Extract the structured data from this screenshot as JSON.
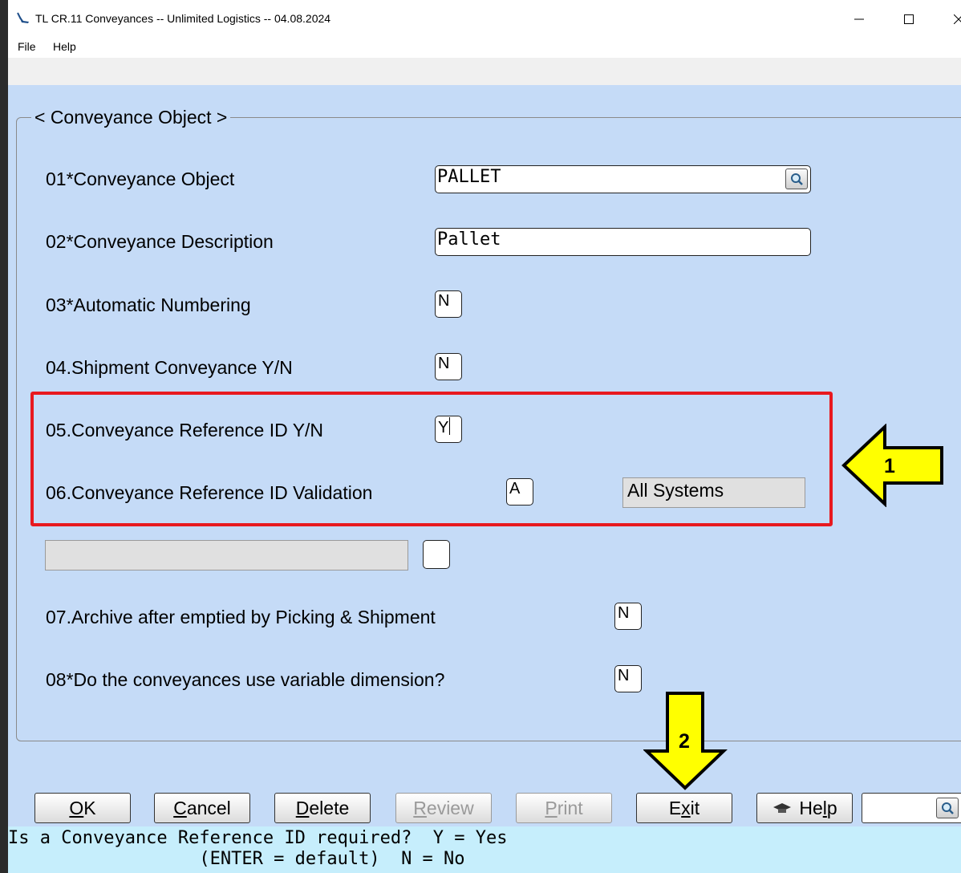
{
  "window": {
    "title": "TL CR.11 Conveyances -- Unlimited Logistics -- 04.08.2024",
    "menu": [
      "File",
      "Help"
    ]
  },
  "group_title": "< Conveyance Object >",
  "fields": [
    {
      "label": "01*Conveyance Object",
      "value": "PALLET"
    },
    {
      "label": "02*Conveyance Description",
      "value": "Pallet"
    },
    {
      "label": "03*Automatic Numbering",
      "value": "N"
    },
    {
      "label": "04.Shipment Conveyance Y/N",
      "value": "N"
    },
    {
      "label": "05.Conveyance Reference ID Y/N",
      "value": "Y"
    },
    {
      "label": "06.Conveyance Reference ID Validation",
      "value": "A",
      "display": "All Systems"
    },
    {
      "label": "",
      "value": "",
      "display": ""
    },
    {
      "label": "07.Archive after emptied by Picking & Shipment",
      "value": "N"
    },
    {
      "label": "08*Do the conveyances use variable dimension?",
      "value": "N"
    }
  ],
  "buttons": {
    "ok": {
      "pre": "",
      "ul": "O",
      "post": "K"
    },
    "cancel": {
      "pre": "",
      "ul": "C",
      "post": "ancel"
    },
    "delete": {
      "pre": "",
      "ul": "D",
      "post": "elete"
    },
    "review": {
      "pre": "",
      "ul": "R",
      "post": "eview"
    },
    "print": {
      "pre": "",
      "ul": "P",
      "post": "rint"
    },
    "exit": {
      "pre": "E",
      "ul": "x",
      "post": "it"
    },
    "help": {
      "pre": "He",
      "ul": "l",
      "post": "p"
    }
  },
  "status": {
    "line1": "Is a Conveyance Reference ID required?  Y = Yes",
    "line2": "                  (ENTER = default)  N = No"
  },
  "annotations": {
    "arrow1": "1",
    "arrow2": "2"
  },
  "colors": {
    "client_bg": "#c5dbf7",
    "status_bg": "#c6eefc",
    "highlight_box": "#e8191f",
    "arrow_fill": "#ffff00"
  }
}
